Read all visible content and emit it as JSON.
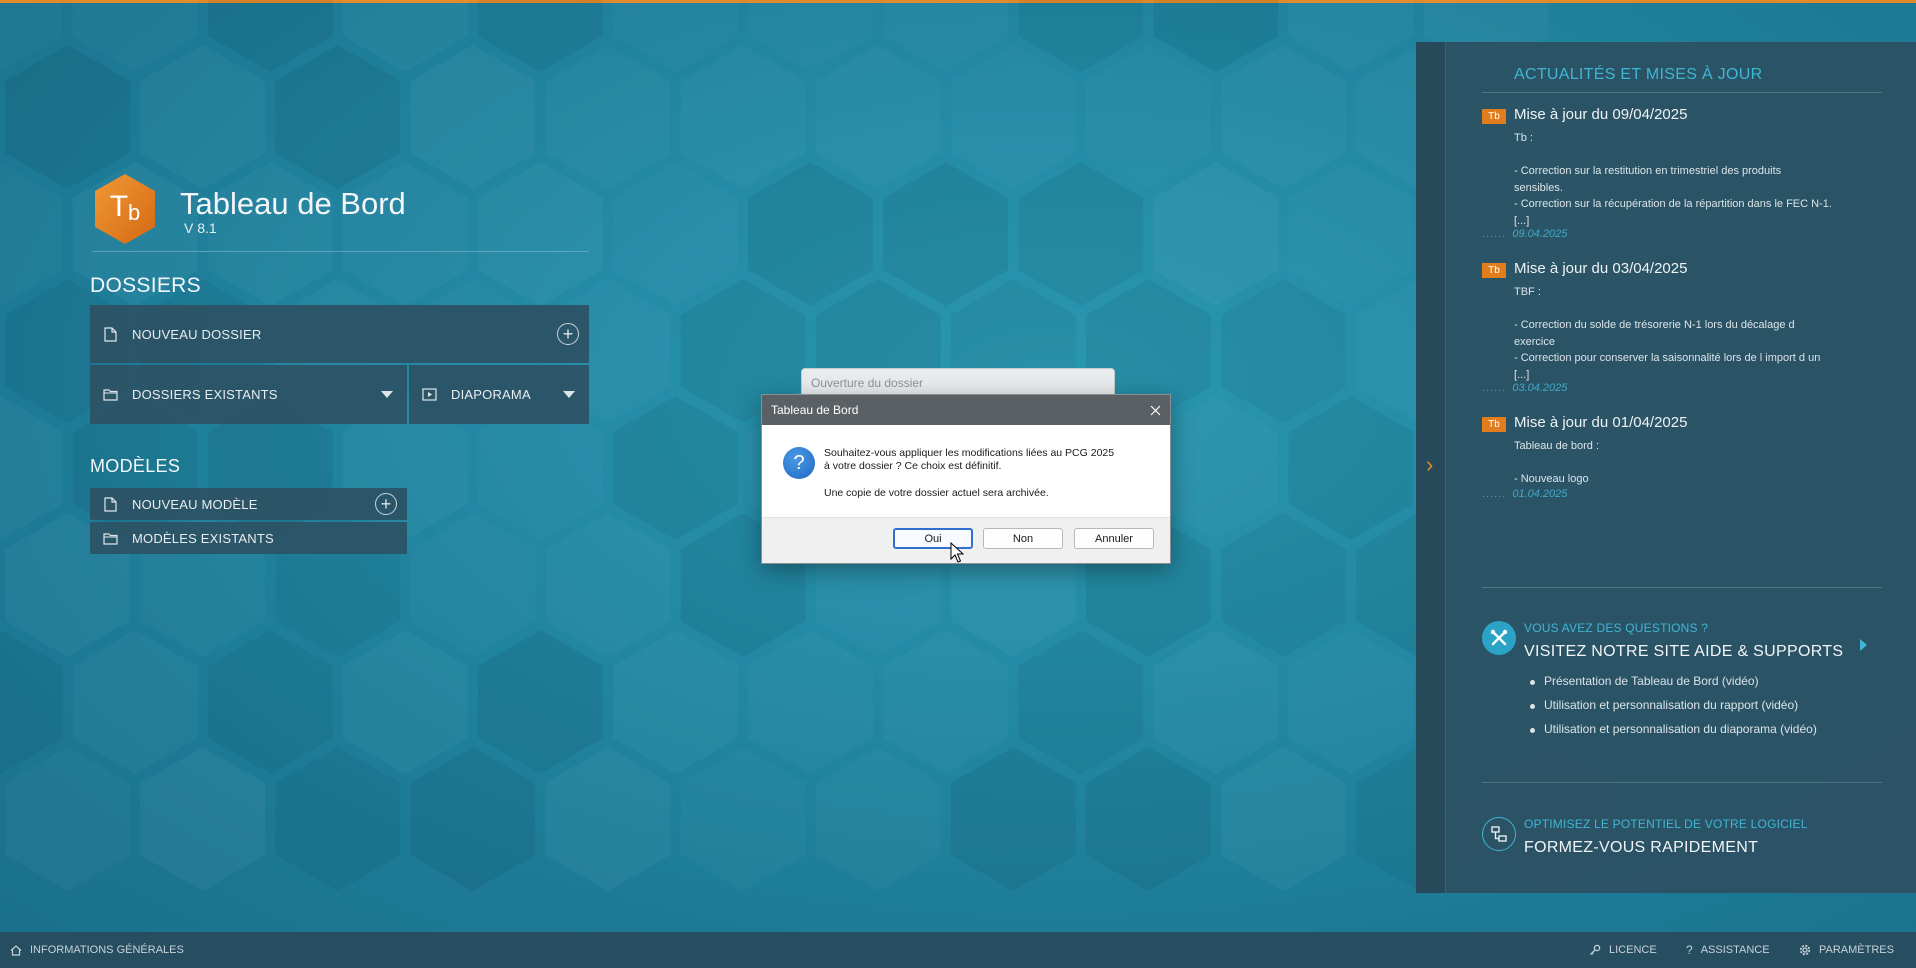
{
  "app": {
    "title": "Tableau de Bord",
    "version": "V 8.1",
    "logo_text": "T",
    "logo_sub": "b",
    "accent_color": "#e08a2a",
    "highlight_color": "#3fb6d4"
  },
  "dossiers": {
    "title": "DOSSIERS",
    "new_label": "NOUVEAU DOSSIER",
    "existing_label": "DOSSIERS EXISTANTS",
    "slideshow_label": "DIAPORAMA"
  },
  "modeles": {
    "title": "MODÈLES",
    "new_label": "NOUVEAU MODÈLE",
    "existing_label": "MODÈLES EXISTANTS"
  },
  "news": {
    "title": "ACTUALITÉS ET MISES À JOUR",
    "items": [
      {
        "badge": "Tb",
        "title": "Mise à jour du 09/04/2025",
        "lines": [
          "Tb :",
          "",
          "- Correction sur la restitution en trimestriel des produits",
          "sensibles.",
          "- Correction sur la récupération de la répartition dans le FEC N-1.",
          "[...]"
        ],
        "date": "09.04.2025"
      },
      {
        "badge": "Tb",
        "title": "Mise à jour du 03/04/2025",
        "lines": [
          "TBF :",
          "",
          "- Correction du solde de trésorerie N-1 lors du décalage d",
          "exercice",
          "- Correction pour conserver la saisonnalité lors de l import d un",
          "[...]"
        ],
        "date": "03.04.2025"
      },
      {
        "badge": "Tb",
        "title": "Mise à jour du 01/04/2025",
        "lines": [
          "Tableau de bord :",
          "",
          "- Nouveau logo"
        ],
        "date": "01.04.2025"
      }
    ]
  },
  "help": {
    "subtitle": "VOUS AVEZ DES QUESTIONS ?",
    "title": "VISITEZ NOTRE SITE AIDE & SUPPORTS",
    "links": [
      "Présentation de Tableau de Bord (vidéo)",
      "Utilisation et personnalisation du rapport (vidéo)",
      "Utilisation et personnalisation du diaporama (vidéo)"
    ]
  },
  "training": {
    "subtitle": "OPTIMISEZ LE POTENTIEL DE VOTRE LOGICIEL",
    "title": "FORMEZ-VOUS RAPIDEMENT"
  },
  "bottombar": {
    "info_label": "INFORMATIONS GÉNÉRALES",
    "license_label": "LICENCE",
    "assistance_label": "ASSISTANCE",
    "settings_label": "PARAMÈTRES"
  },
  "loading_window": {
    "title": "Ouverture du dossier"
  },
  "dialog": {
    "title": "Tableau de Bord",
    "message_line1": "Souhaitez-vous appliquer les modifications liées au PCG 2025",
    "message_line2": "à votre dossier ? Ce choix est définitif.",
    "message2": "Une copie de votre dossier actuel sera archivée.",
    "icon": "?",
    "yes_label": "Oui",
    "no_label": "Non",
    "cancel_label": "Annuler"
  }
}
